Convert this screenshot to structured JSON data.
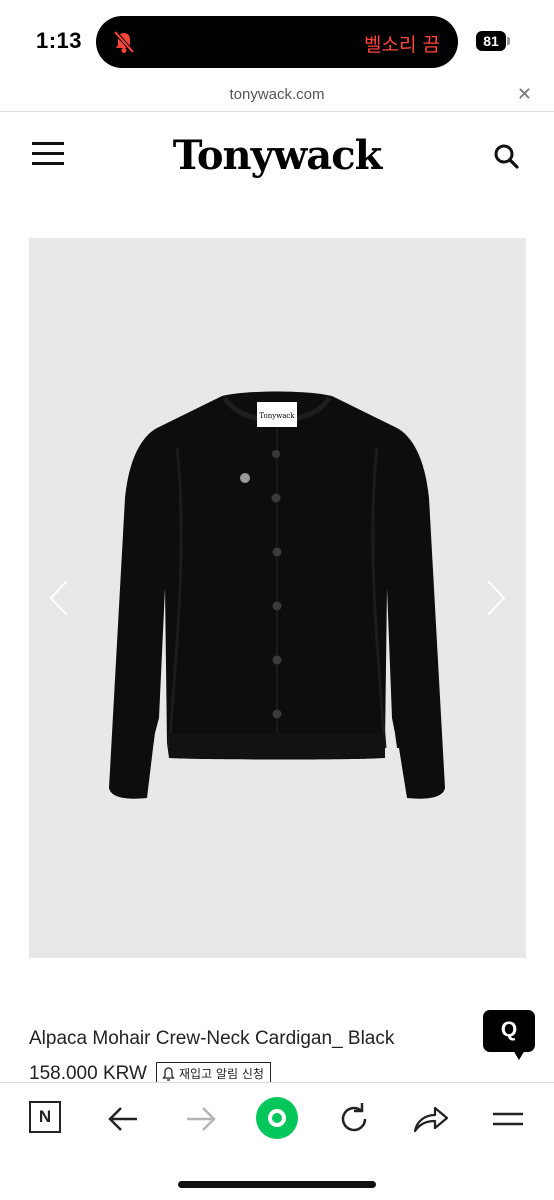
{
  "status_bar": {
    "time": "1:13",
    "island_text": "벨소리 끔",
    "battery": "81"
  },
  "browser": {
    "url": "tonywack.com",
    "close_icon": "close-icon"
  },
  "site": {
    "logo": "Tonywack",
    "menu_icon": "hamburger-icon",
    "search_icon": "search-icon"
  },
  "product": {
    "title": "Alpaca Mohair Crew-Neck Cardigan_ Black",
    "price": "158.000 KRW",
    "restock_label": "재입고 알림 신청",
    "image_bg": "#e8e8e8",
    "garment_color": "#0d0d0d",
    "label_text": "Tonywack"
  },
  "chat": {
    "label": "Q"
  },
  "toolbar": {
    "naver_label": "N",
    "accent": "#03c75a",
    "icons": [
      "naver-icon",
      "back-arrow-icon",
      "forward-arrow-icon",
      "green-circle-icon",
      "reload-icon",
      "share-icon",
      "menu-icon"
    ]
  }
}
